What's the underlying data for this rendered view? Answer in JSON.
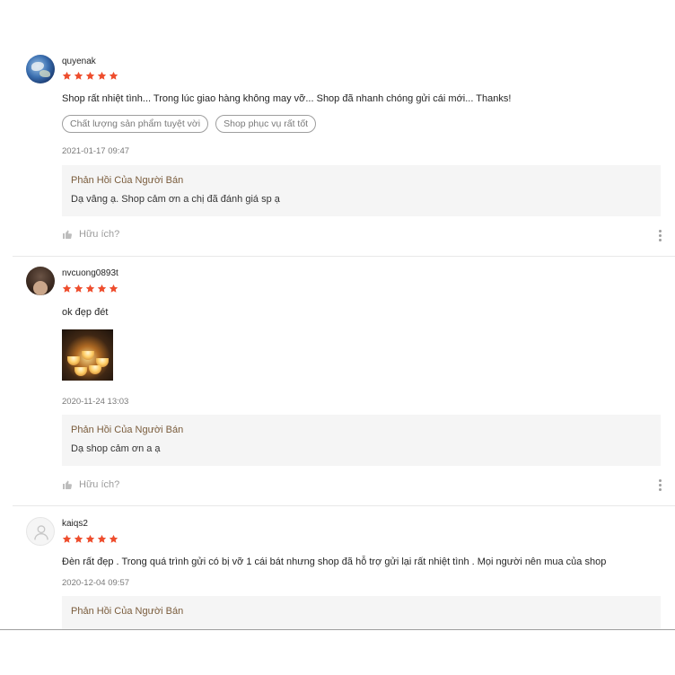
{
  "colors": {
    "star": "#ee4d2d",
    "reply_title": "#7a5c3c",
    "reply_bg": "#f5f5f5"
  },
  "reviews": [
    {
      "username": "quyenak",
      "rating": 5,
      "comment": "Shop rất nhiệt tình... Trong lúc giao hàng không may vỡ... Shop đã nhanh chóng gửi cái mới... Thanks!",
      "tags": [
        "Chất lượng sản phẩm tuyệt vời",
        "Shop phục vụ rất tốt"
      ],
      "date": "2021-01-17 09:47",
      "reply_title": "Phản Hồi Của Người Bán",
      "reply_text": "Dạ vâng ạ. Shop cảm ơn a chị đã đánh giá sp ạ",
      "helpful_label": "Hữu ích?"
    },
    {
      "username": "nvcuong0893t",
      "rating": 5,
      "comment": "ok đẹp đét",
      "date": "2020-11-24 13:03",
      "reply_title": "Phản Hồi Của Người Bán",
      "reply_text": "Dạ shop cảm ơn a ạ",
      "helpful_label": "Hữu ích?"
    },
    {
      "username": "kaiqs2",
      "rating": 5,
      "comment": "Đèn rất đẹp . Trong quá trình gửi có bị vỡ 1 cái bát nhưng shop đã hỗ trợ gửi lại rất nhiệt tình . Mọi người nên mua của shop",
      "date": "2020-12-04 09:57",
      "reply_title": "Phản Hồi Của Người Bán"
    }
  ]
}
